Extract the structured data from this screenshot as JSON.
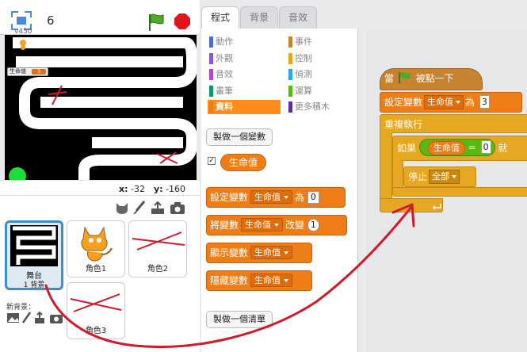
{
  "stage": {
    "version": "v450",
    "number": "6",
    "monitor": {
      "label": "生命值",
      "value": "3"
    },
    "coords": {
      "x_label": "x:",
      "x_value": "-32",
      "y_label": "y:",
      "y_value": "-160"
    }
  },
  "sprites": {
    "stage_thumb": {
      "label": "舞台",
      "sublabel": "1 背景"
    },
    "items": [
      {
        "name": "角色1"
      },
      {
        "name": "角色2"
      },
      {
        "name": "角色3"
      }
    ],
    "new_backdrop_label": "新背景："
  },
  "tabs": [
    {
      "label": "程式",
      "active": true
    },
    {
      "label": "背景",
      "active": false
    },
    {
      "label": "音效",
      "active": false
    }
  ],
  "categories": [
    {
      "label": "動作",
      "color": "#4a6cd4"
    },
    {
      "label": "事件",
      "color": "#c88330"
    },
    {
      "label": "外觀",
      "color": "#8a55d7"
    },
    {
      "label": "控制",
      "color": "#e1a91a"
    },
    {
      "label": "音效",
      "color": "#bb42c3"
    },
    {
      "label": "偵測",
      "color": "#2ca5e2"
    },
    {
      "label": "畫筆",
      "color": "#0e9a6c"
    },
    {
      "label": "運算",
      "color": "#5cb712"
    },
    {
      "label": "資料",
      "color": "#ee7d16",
      "selected": true
    },
    {
      "label": "更多積木",
      "color": "#632d99"
    }
  ],
  "palette": {
    "make_variable": "製做一個變數",
    "variable_checked": "✓",
    "variable_name": "生命值",
    "blocks": {
      "set": {
        "prefix": "設定變數",
        "var": "生命值",
        "mid": "為",
        "value": "0"
      },
      "change": {
        "prefix": "將變數",
        "var": "生命值",
        "mid": "改變",
        "value": "1"
      },
      "show": {
        "prefix": "顯示變數",
        "var": "生命值"
      },
      "hide": {
        "prefix": "隱藏變數",
        "var": "生命值"
      }
    },
    "make_list": "製做一個清單"
  },
  "script": {
    "hat": {
      "prefix": "當",
      "suffix": "被點一下"
    },
    "set": {
      "prefix": "設定變數",
      "var": "生命值",
      "mid": "為",
      "value": "3"
    },
    "forever": "重複執行",
    "if": {
      "prefix": "如果",
      "var": "生命值",
      "op": "=",
      "value": "0",
      "suffix": "就"
    },
    "stop": {
      "prefix": "停止",
      "option": "全部"
    }
  },
  "colors": {
    "accent_data": "#ee7d16",
    "control": "#e6a822",
    "events": "#c88330",
    "arrow": "#d11a2a"
  }
}
